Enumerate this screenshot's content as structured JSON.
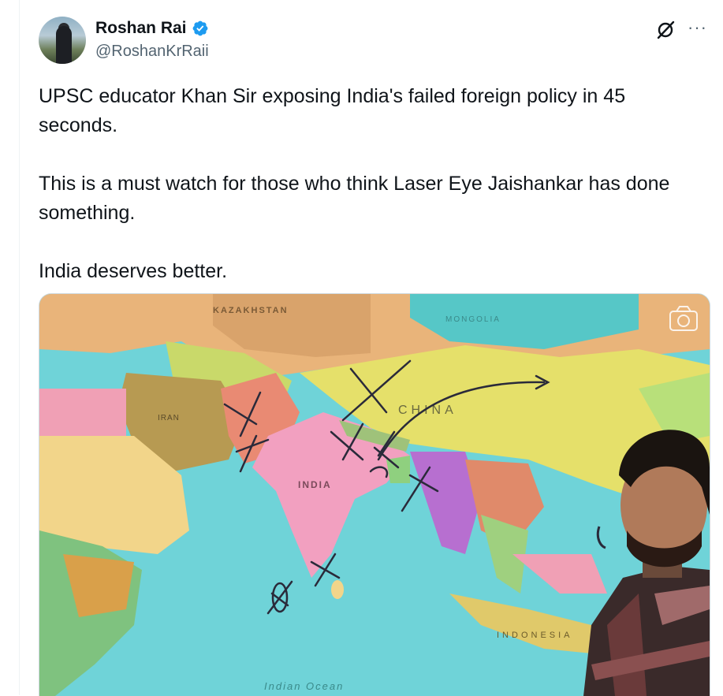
{
  "author": {
    "display_name": "Roshan Rai",
    "handle": "@RoshanKrRaii",
    "verified": true,
    "avatar_icon": "avatar"
  },
  "actions": {
    "grok_icon": "grok-icon",
    "more_icon": "more-icon",
    "more_glyph": "···"
  },
  "tweet": {
    "text": "UPSC educator Khan Sir exposing India's failed foreign policy in 45\nseconds.\n\nThis is a must watch for those who think Laser Eye Jaishankar has done\nsomething.\n\nIndia deserves better."
  },
  "media": {
    "map_labels": {
      "kazakhstan": "KAZAKHSTAN",
      "mongolia": "MONGOLIA",
      "china": "CHINA",
      "iran": "IRAN",
      "india": "INDIA",
      "indonesia": "INDONESIA",
      "indian_ocean": "Indian  Ocean"
    },
    "camera_icon": "camera-icon"
  },
  "colors": {
    "verified_blue": "#1d9bf0",
    "text_primary": "#0f1419",
    "text_secondary": "#536471",
    "ocean": "#6fd3d8"
  }
}
